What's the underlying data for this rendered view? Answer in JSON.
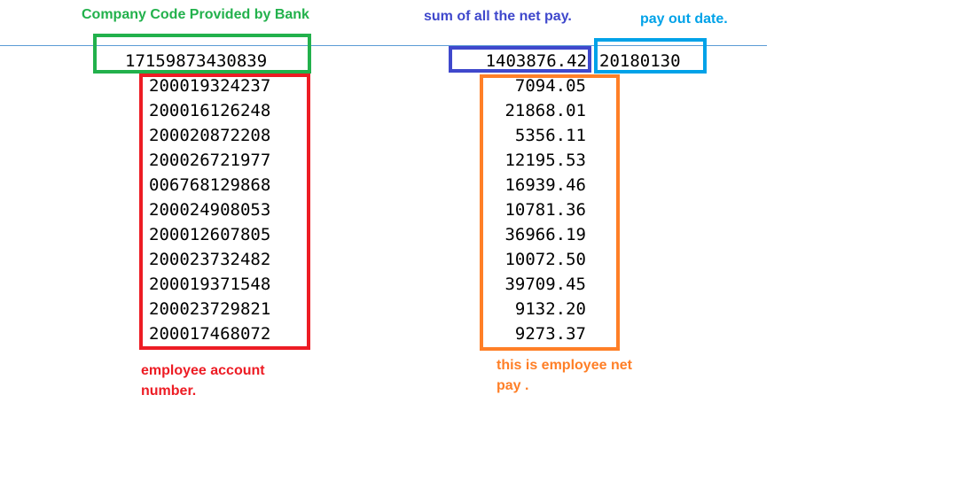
{
  "annotations": {
    "company_code_label": "Company Code Provided by Bank",
    "total_label": "sum of all the net pay.",
    "date_label": "pay out date.",
    "account_label": "employee account number.",
    "net_pay_label": "this is employee net pay ."
  },
  "header_record": {
    "company_code": "17159873430839",
    "total_net_pay": "1403876.42",
    "pay_out_date": "20180130"
  },
  "employees": [
    {
      "account": "200019324237",
      "net_pay": "7094.05"
    },
    {
      "account": "200016126248",
      "net_pay": "21868.01"
    },
    {
      "account": "200020872208",
      "net_pay": "5356.11"
    },
    {
      "account": "200026721977",
      "net_pay": "12195.53"
    },
    {
      "account": "006768129868",
      "net_pay": "16939.46"
    },
    {
      "account": "200024908053",
      "net_pay": "10781.36"
    },
    {
      "account": "200012607805",
      "net_pay": "36966.19"
    },
    {
      "account": "200023732482",
      "net_pay": "10072.50"
    },
    {
      "account": "200019371548",
      "net_pay": "39709.45"
    },
    {
      "account": "200023729821",
      "net_pay": "9132.20"
    },
    {
      "account": "200017468072",
      "net_pay": "9273.37"
    }
  ],
  "colors": {
    "company_code_highlight": "#22b14c",
    "account_highlight": "#ed1c24",
    "total_highlight": "#3f48cc",
    "date_highlight": "#00a2e8",
    "net_pay_highlight": "#ff7f27"
  }
}
